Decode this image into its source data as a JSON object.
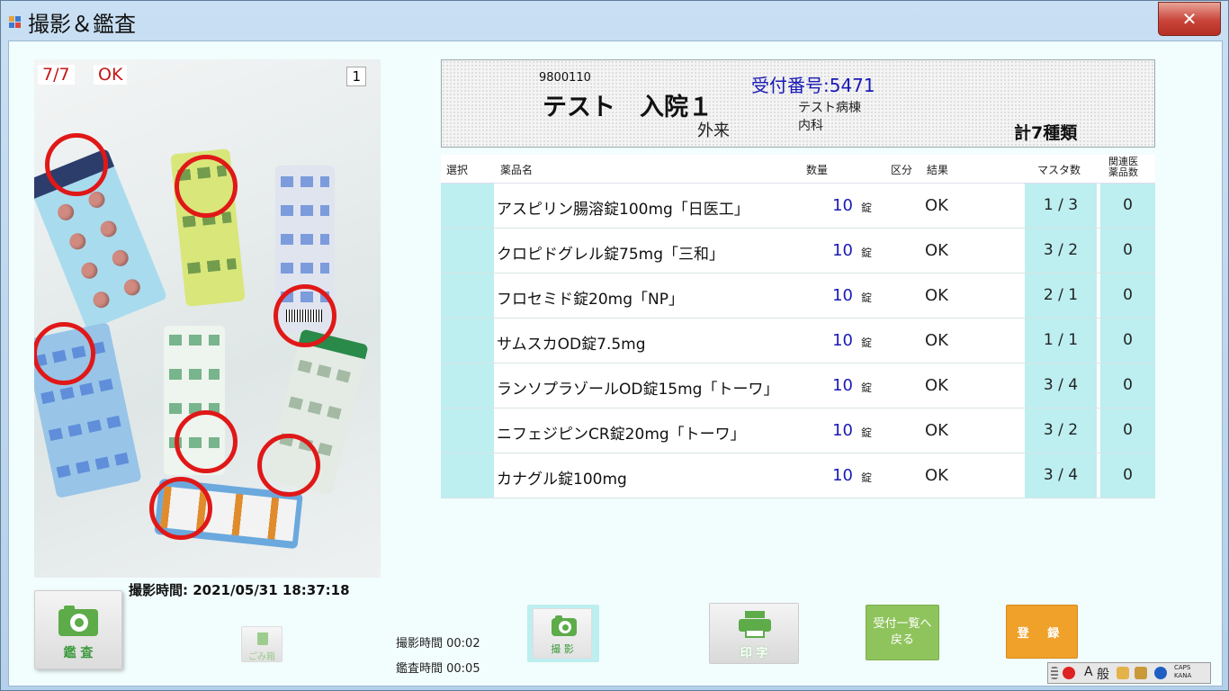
{
  "window": {
    "title": "撮影＆鑑査",
    "close_glyph": "✕"
  },
  "photo": {
    "count": "7/7",
    "status": "OK",
    "index": "1",
    "shot_time": "撮影時間: 2021/05/31 18:37:18"
  },
  "patient": {
    "id": "9800110",
    "name": "テスト　入院１",
    "visit_type": "外来",
    "reception_label": "受付番号:5471",
    "ward": "テスト病棟",
    "department": "内科",
    "total": "計7種類"
  },
  "table": {
    "headers": {
      "select": "選択",
      "name": "薬品名",
      "qty": "数量",
      "category": "区分",
      "result": "結果",
      "master": "マスタ数",
      "related": "関連医\n薬品数"
    },
    "rows": [
      {
        "name": "アスピリン腸溶錠100mg「日医工」",
        "qty": "10",
        "unit": "錠",
        "result": "OK",
        "master": "1 / 3",
        "related": "0"
      },
      {
        "name": "クロピドグレル錠75mg「三和」",
        "qty": "10",
        "unit": "錠",
        "result": "OK",
        "master": "3 / 2",
        "related": "0"
      },
      {
        "name": "フロセミド錠20mg「NP」",
        "qty": "10",
        "unit": "錠",
        "result": "OK",
        "master": "2 / 1",
        "related": "0"
      },
      {
        "name": "サムスカOD錠7.5mg",
        "qty": "10",
        "unit": "錠",
        "result": "OK",
        "master": "1 / 1",
        "related": "0"
      },
      {
        "name": "ランソプラゾールOD錠15mg「トーワ」",
        "qty": "10",
        "unit": "錠",
        "result": "OK",
        "master": "3 / 4",
        "related": "0"
      },
      {
        "name": "ニフェジピンCR錠20mg「トーワ」",
        "qty": "10",
        "unit": "錠",
        "result": "OK",
        "master": "3 / 2",
        "related": "0"
      },
      {
        "name": "カナグル錠100mg",
        "qty": "10",
        "unit": "錠",
        "result": "OK",
        "master": "3 / 4",
        "related": "0"
      }
    ]
  },
  "buttons": {
    "audit": "鑑 査",
    "trash": "ごみ箱",
    "shoot": "撮 影",
    "print": "印 字",
    "back": "受付一覧へ\n戻る",
    "register": "登 録"
  },
  "timings": {
    "shoot": "撮影時間 00:02",
    "audit": "鑑査時間 00:05"
  },
  "ime": {
    "mode": "A",
    "kana": "般",
    "caps": "CAPS",
    "kana_lbl": "KANA"
  },
  "colors": {
    "accent_cyan": "#bdeef0",
    "ok_red": "#e01818",
    "green": "#5dab49",
    "orange": "#f0a12a",
    "blue_text": "#1a1ab6"
  }
}
